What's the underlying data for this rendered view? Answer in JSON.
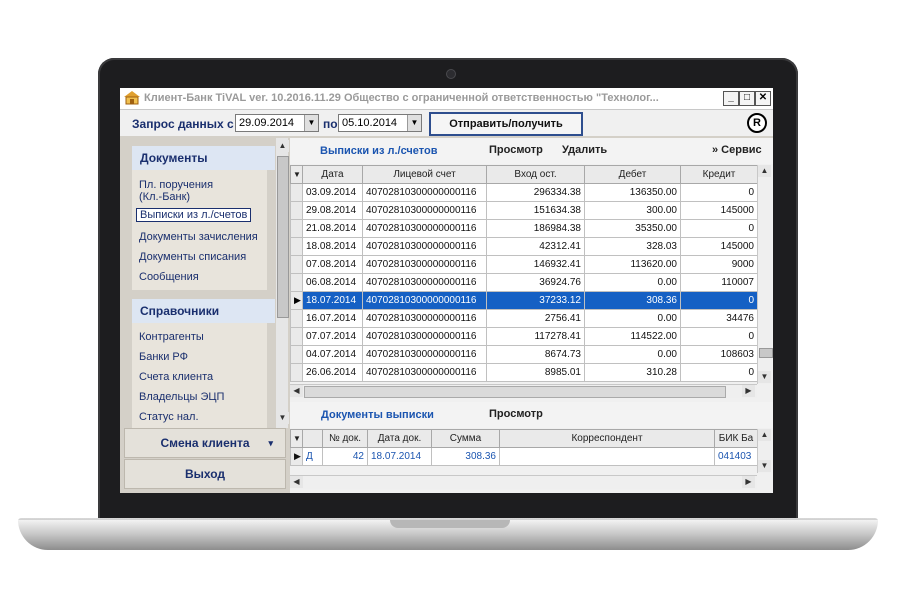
{
  "window": {
    "title": "Клиент-Банк TiVAL ver. 10.2016.11.29  Общество с ограниченной ответственностью \"Технолог...",
    "min": "_",
    "max": "□",
    "close": "✕"
  },
  "toolbar": {
    "request_label": "Запрос данных с",
    "date_from": "29.09.2014",
    "to_label": "по",
    "date_to": "05.10.2014",
    "send_button": "Отправить/получить",
    "reg_mark": "R"
  },
  "sidebar": {
    "documents_header": "Документы",
    "documents_items": [
      "Пл. поручения (Кл.-Банк)",
      "Выписки из л./счетов",
      "Документы зачисления",
      "Документы списания",
      "Сообщения"
    ],
    "refs_header": "Справочники",
    "refs_items": [
      "Контрагенты",
      "Банки РФ",
      "Счета клиента",
      "Владельцы ЭЦП",
      "Статус нал."
    ],
    "change_client": "Смена клиента",
    "change_client_arrow": "▾",
    "exit": "Выход"
  },
  "statements": {
    "title": "Выписки из л./счетов",
    "view": "Просмотр",
    "delete": "Удалить",
    "service": "» Сервис",
    "columns": [
      "Дата",
      "Лицевой счет",
      "Вход ост.",
      "Дебет",
      "Кредит"
    ],
    "rows": [
      [
        "03.09.2014",
        "40702810300000000116",
        "296334.38",
        "136350.00",
        "0"
      ],
      [
        "29.08.2014",
        "40702810300000000116",
        "151634.38",
        "300.00",
        "145000"
      ],
      [
        "21.08.2014",
        "40702810300000000116",
        "186984.38",
        "35350.00",
        "0"
      ],
      [
        "18.08.2014",
        "40702810300000000116",
        "42312.41",
        "328.03",
        "145000"
      ],
      [
        "07.08.2014",
        "40702810300000000116",
        "146932.41",
        "113620.00",
        "9000"
      ],
      [
        "06.08.2014",
        "40702810300000000116",
        "36924.76",
        "0.00",
        "110007"
      ],
      [
        "18.07.2014",
        "40702810300000000116",
        "37233.12",
        "308.36",
        "0"
      ],
      [
        "16.07.2014",
        "40702810300000000116",
        "2756.41",
        "0.00",
        "34476"
      ],
      [
        "07.07.2014",
        "40702810300000000116",
        "117278.41",
        "114522.00",
        "0"
      ],
      [
        "04.07.2014",
        "40702810300000000116",
        "8674.73",
        "0.00",
        "108603"
      ],
      [
        "26.06.2014",
        "40702810300000000116",
        "8985.01",
        "310.28",
        "0"
      ]
    ],
    "selected_index": 6
  },
  "statement_docs": {
    "title": "Документы выписки",
    "view": "Просмотр",
    "columns": [
      "№ док.",
      "Дата док.",
      "Сумма",
      "Корреспондент",
      "БИК Ба"
    ],
    "rows": [
      [
        "Д",
        "42",
        "18.07.2014",
        "308.36",
        "",
        "041403"
      ]
    ]
  },
  "colors": {
    "accent_blue": "#1b55b0",
    "selection": "#1560c4",
    "panel_bg": "#d4d0c8"
  }
}
